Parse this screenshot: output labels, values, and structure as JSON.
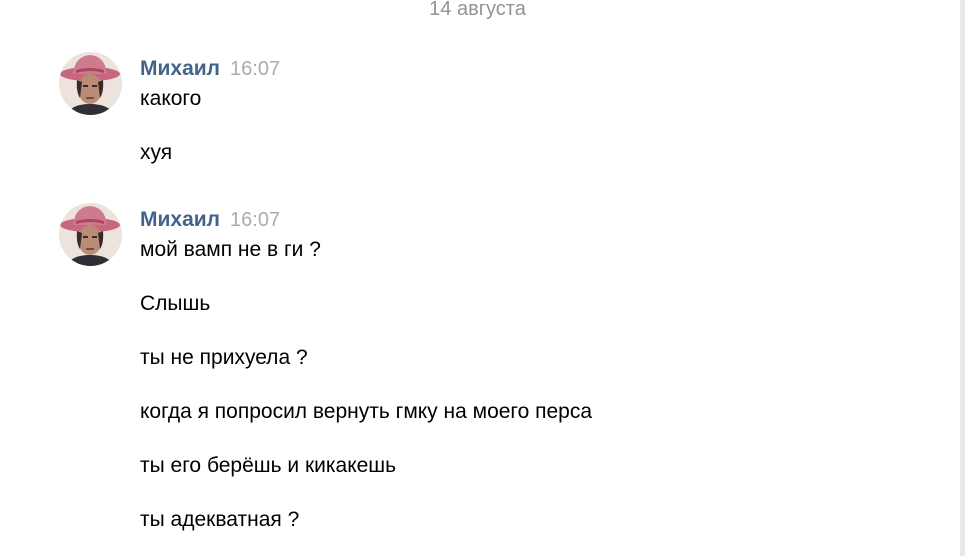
{
  "date_separator": "14 августа",
  "groups": [
    {
      "author": "Михаил",
      "time": "16:07",
      "messages": [
        "какого",
        "хуя"
      ]
    },
    {
      "author": "Михаил",
      "time": "16:07",
      "messages": [
        "мой вамп не в ги ?",
        "Слышь",
        "ты не прихуела ?",
        "когда я попросил вернуть гмку на моего перса",
        "ты его берёшь и кикакешь",
        "ты адекватная ?"
      ]
    }
  ],
  "colors": {
    "author": "#42648b",
    "time": "#a8adb3",
    "date": "#939393",
    "text": "#000000"
  },
  "icons": {
    "avatar": "user-avatar-photo"
  }
}
